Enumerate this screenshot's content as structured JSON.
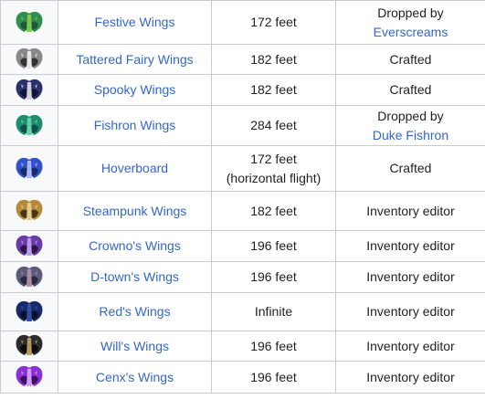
{
  "rows": [
    {
      "icon": "festive-wings-icon",
      "colors": [
        "#1f5a3a",
        "#2f8f4f",
        "#7ec850"
      ],
      "name": "Festive Wings",
      "height": [
        "172 feet"
      ],
      "obtain_lines": [
        "Dropped by"
      ],
      "obtain_link": "Everscreams"
    },
    {
      "icon": "tattered-fairy-wings-icon",
      "colors": [
        "#333333",
        "#888888",
        "#e6e6e6"
      ],
      "name": "Tattered Fairy Wings",
      "height": [
        "182 feet"
      ],
      "obtain_lines": [
        "Crafted"
      ],
      "obtain_link": ""
    },
    {
      "icon": "spooky-wings-icon",
      "colors": [
        "#121433",
        "#2c2f6b",
        "#d1d1e0"
      ],
      "name": "Spooky Wings",
      "height": [
        "182 feet"
      ],
      "obtain_lines": [
        "Crafted"
      ],
      "obtain_link": ""
    },
    {
      "icon": "fishron-wings-icon",
      "colors": [
        "#0f4f4a",
        "#1e8c6f",
        "#62d1a7"
      ],
      "name": "Fishron Wings",
      "height": [
        "284 feet"
      ],
      "obtain_lines": [
        "Dropped by"
      ],
      "obtain_link": "Duke Fishron"
    },
    {
      "icon": "hoverboard-icon",
      "colors": [
        "#1a2a6b",
        "#3250c9",
        "#a7b6ff"
      ],
      "name": "Hoverboard",
      "height": [
        "172 feet",
        "(horizontal flight)"
      ],
      "obtain_lines": [
        "Crafted"
      ],
      "obtain_link": ""
    },
    {
      "icon": "steampunk-wings-icon",
      "colors": [
        "#4a3418",
        "#b58a3a",
        "#e3c890"
      ],
      "name": "Steampunk Wings",
      "height": [
        "182 feet"
      ],
      "obtain_lines": [
        "Inventory editor"
      ],
      "obtain_link": ""
    },
    {
      "icon": "crownos-wings-icon",
      "colors": [
        "#2a1747",
        "#6a3aa6",
        "#b89ae6"
      ],
      "name": "Crowno's Wings",
      "height": [
        "196 feet"
      ],
      "obtain_lines": [
        "Inventory editor"
      ],
      "obtain_link": ""
    },
    {
      "icon": "d-towns-wings-icon",
      "colors": [
        "#2b2b40",
        "#5b5b7a",
        "#b08aa9"
      ],
      "name": "D-town's Wings",
      "height": [
        "196 feet"
      ],
      "obtain_lines": [
        "Inventory editor"
      ],
      "obtain_link": ""
    },
    {
      "icon": "reds-wings-icon",
      "colors": [
        "#0b0f2a",
        "#182a6a",
        "#2f4fa3"
      ],
      "name": "Red's Wings",
      "height": [
        "Infinite"
      ],
      "obtain_lines": [
        "Inventory editor"
      ],
      "obtain_link": ""
    },
    {
      "icon": "wills-wings-icon",
      "colors": [
        "#0b0b0b",
        "#2b2b2b",
        "#b59a5b"
      ],
      "name": "Will's Wings",
      "height": [
        "196 feet"
      ],
      "obtain_lines": [
        "Inventory editor"
      ],
      "obtain_link": ""
    },
    {
      "icon": "cenxs-wings-icon",
      "colors": [
        "#3b0f5a",
        "#8a2fd1",
        "#d09aff"
      ],
      "name": "Cenx's Wings",
      "height": [
        "196 feet"
      ],
      "obtain_lines": [
        "Inventory editor"
      ],
      "obtain_link": ""
    }
  ]
}
